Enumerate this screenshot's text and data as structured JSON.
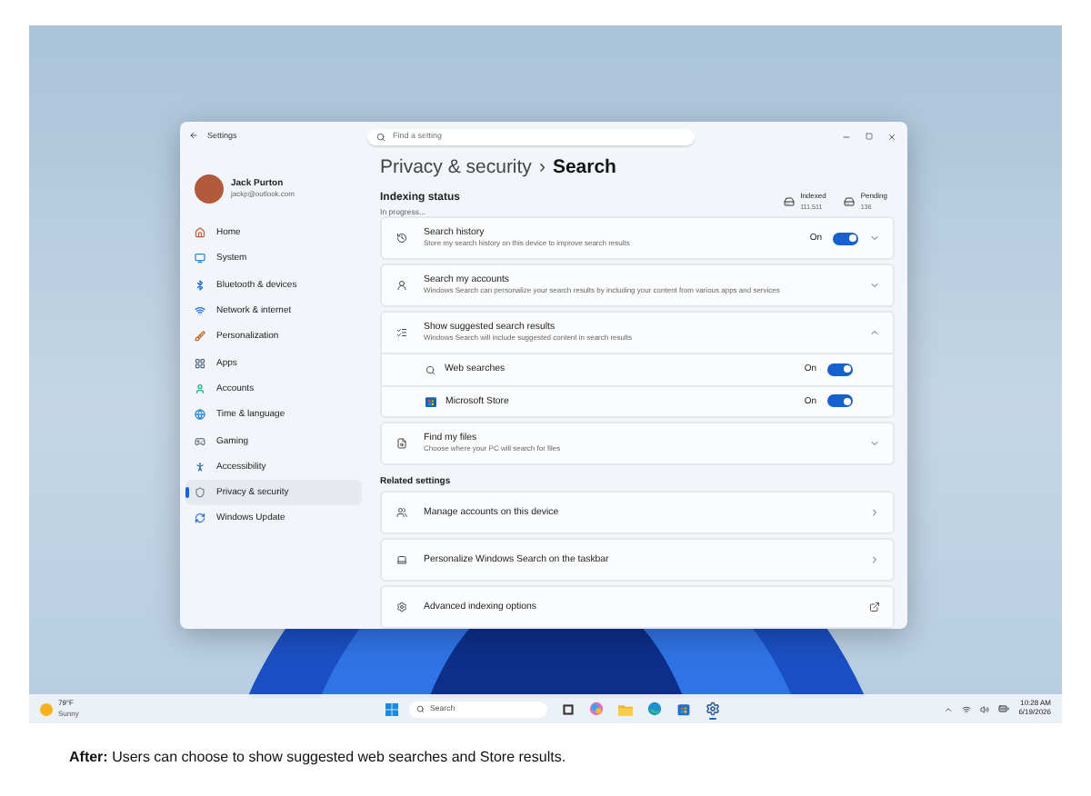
{
  "window": {
    "title": "Settings",
    "search": {
      "placeholder": "Find a setting"
    }
  },
  "profile": {
    "name": "Jack Purton",
    "email": "jackp@outlook.com"
  },
  "sidebar": {
    "items": [
      {
        "label": "Home",
        "selected": false
      },
      {
        "label": "System",
        "selected": false
      },
      {
        "label": "Bluetooth & devices",
        "selected": false
      },
      {
        "label": "Network & internet",
        "selected": false
      },
      {
        "label": "Personalization",
        "selected": false
      },
      {
        "label": "Apps",
        "selected": false
      },
      {
        "label": "Accounts",
        "selected": false
      },
      {
        "label": "Time & language",
        "selected": false
      },
      {
        "label": "Gaming",
        "selected": false
      },
      {
        "label": "Accessibility",
        "selected": false
      },
      {
        "label": "Privacy & security",
        "selected": true
      },
      {
        "label": "Windows Update",
        "selected": false
      }
    ]
  },
  "breadcrumb": {
    "parent": "Privacy & security",
    "separator": "›",
    "current": "Search"
  },
  "indexing": {
    "title": "Indexing status",
    "status": "In progress...",
    "stats": [
      {
        "label": "Indexed",
        "value": "111,511"
      },
      {
        "label": "Pending",
        "value": "136"
      }
    ]
  },
  "settings": [
    {
      "title": "Search history",
      "description": "Store my search history on this device to improve search results",
      "toggle": {
        "on": true,
        "label": "On"
      },
      "expanded": false
    },
    {
      "title": "Search my accounts",
      "description": "Windows Search can personalize your search results by including your content from various apps and services",
      "expanded": false
    },
    {
      "title": "Show suggested search results",
      "description": "Windows Search will include suggested content in search results",
      "expanded": true,
      "children": [
        {
          "title": "Web searches",
          "toggle": {
            "on": true,
            "label": "On"
          }
        },
        {
          "title": "Microsoft Store",
          "toggle": {
            "on": true,
            "label": "On"
          }
        }
      ]
    },
    {
      "title": "Find my files",
      "description": "Choose where your PC will search for files",
      "expanded": false
    }
  ],
  "related": {
    "title": "Related settings",
    "items": [
      {
        "label": "Manage accounts on this device",
        "kind": "link"
      },
      {
        "label": "Personalize Windows Search on the taskbar",
        "kind": "link"
      },
      {
        "label": "Advanced indexing options",
        "kind": "external"
      }
    ]
  },
  "taskbar": {
    "weather": {
      "temp": "79°F",
      "condition": "Sunny"
    },
    "search": {
      "placeholder": "Search"
    },
    "apps": [
      {
        "kind": "task-view",
        "active": false
      },
      {
        "kind": "copilot",
        "active": false
      },
      {
        "kind": "files",
        "active": false
      },
      {
        "kind": "edge",
        "active": false
      },
      {
        "kind": "store",
        "active": false
      },
      {
        "kind": "settings",
        "active": true
      }
    ],
    "clock": {
      "time": "10:28 AM",
      "date": "6/19/2026"
    }
  },
  "caption": {
    "text": "**After:** Users can choose to show suggested web searches and Store results."
  }
}
